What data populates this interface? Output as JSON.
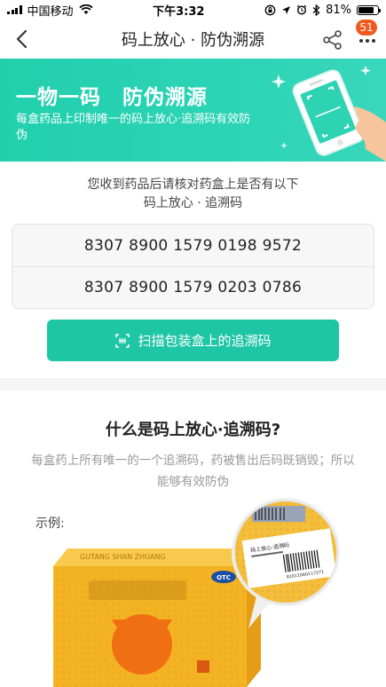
{
  "status_bar": {
    "carrier": "中国移动",
    "time": "下午3:32",
    "battery_text": "81%",
    "battery_level": 0.81,
    "icons": [
      "signal-icon",
      "wifi-icon",
      "lock-rotation-icon",
      "location-icon",
      "alarm-icon",
      "bluetooth-icon",
      "battery-icon"
    ]
  },
  "nav": {
    "title": "码上放心 · 防伪溯源",
    "badge_count": "51",
    "icons": [
      "back-icon",
      "share-icon",
      "more-icon"
    ]
  },
  "banner": {
    "title": "一物一码　防伪溯源",
    "subtitle": "每盒药品上印制唯一的码上放心·追溯码有效防伪"
  },
  "verify": {
    "intro_line1": "您收到药品后请核对药盒上是否有以下",
    "intro_line2": "码上放心 · 追溯码",
    "codes": [
      "8307 8900 1579 0198 9572",
      "8307 8900 1579 0203 0786"
    ],
    "scan_label": "扫描包装盒上的追溯码"
  },
  "about": {
    "title": "什么是码上放心·追溯码?",
    "description": "每盒药上所有唯一的一个追溯码，药被售出后码既销毁；所以能够有效防伪",
    "example_label": "示例:",
    "box_label": "OTC",
    "box_top_text": "GUTANG SHAN ZHUANG",
    "sticker_title": "码上放心·追溯码",
    "sticker_number": "81011060117271"
  },
  "colors": {
    "accent": "#1fc6a5",
    "banner": "#2cd4b6",
    "badge": "#f05a1e",
    "box": "#f4b323"
  }
}
